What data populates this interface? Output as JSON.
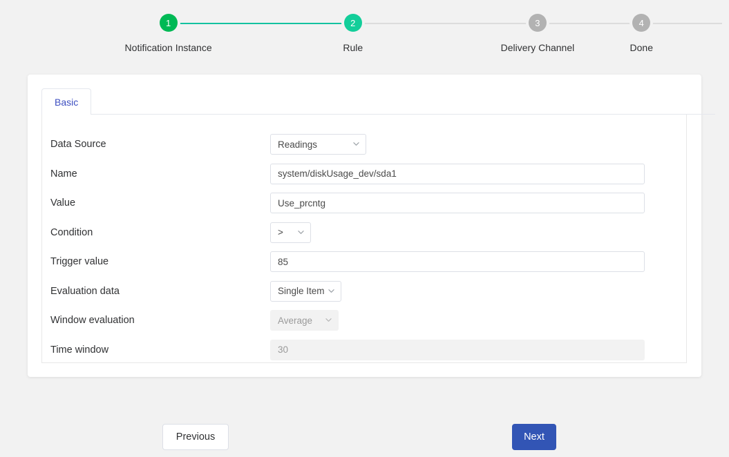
{
  "colors": {
    "step_done": "#00b955",
    "step_active": "#13ce9a",
    "step_inactive": "#b2b2b2",
    "line_done": "#13c2a0",
    "line_inactive": "#dcdcdc",
    "primary_button": "#3255b5",
    "tab_text": "#3c4ec0",
    "page_background": "#f2f2f2"
  },
  "stepper": {
    "steps": [
      {
        "number": "1",
        "label": "Notification Instance",
        "state": "done"
      },
      {
        "number": "2",
        "label": "Rule",
        "state": "active"
      },
      {
        "number": "3",
        "label": "Delivery Channel",
        "state": "inactive"
      },
      {
        "number": "4",
        "label": "Done",
        "state": "inactive"
      }
    ]
  },
  "card": {
    "tabs": [
      {
        "label": "Basic",
        "selected": true
      }
    ],
    "form": {
      "rows": [
        {
          "label": "Data Source",
          "control": "select",
          "value": "Readings",
          "disabled": false,
          "icon": "chevron-down-icon",
          "name": "data-source"
        },
        {
          "label": "Name",
          "control": "input",
          "value": "system/diskUsage_dev/sda1",
          "placeholder": "",
          "disabled": false,
          "name": "name"
        },
        {
          "label": "Value",
          "control": "input",
          "value": "Use_prcntg",
          "placeholder": "",
          "disabled": false,
          "name": "value"
        },
        {
          "label": "Condition",
          "control": "select",
          "value": ">",
          "disabled": false,
          "icon": "chevron-down-icon",
          "name": "condition"
        },
        {
          "label": "Trigger value",
          "control": "input",
          "value": "85",
          "placeholder": "",
          "disabled": false,
          "name": "trigger-value"
        },
        {
          "label": "Evaluation data",
          "control": "select",
          "value": "Single Item",
          "disabled": false,
          "icon": "chevron-down-icon",
          "name": "evaluation-data"
        },
        {
          "label": "Window evaluation",
          "control": "select",
          "value": "Average",
          "disabled": true,
          "icon": "chevron-down-icon",
          "name": "window-evaluation"
        },
        {
          "label": "Time window",
          "control": "input",
          "value": "30",
          "placeholder": "",
          "disabled": true,
          "name": "time-window"
        }
      ]
    }
  },
  "footer": {
    "previous_label": "Previous",
    "next_label": "Next"
  }
}
